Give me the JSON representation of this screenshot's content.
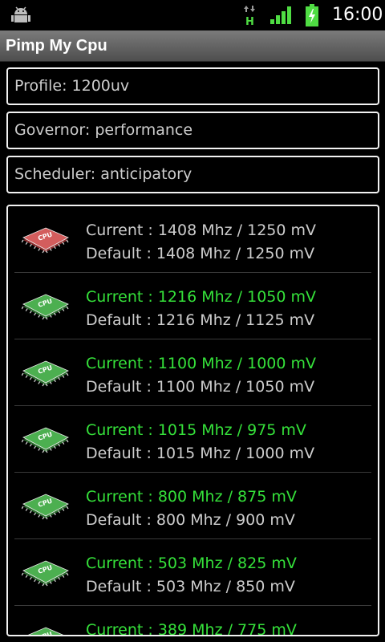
{
  "status_bar": {
    "time": "16:00",
    "icons": [
      "android-debug-icon",
      "network-data-icon",
      "signal-strength-icon",
      "battery-charging-icon"
    ],
    "network_label": "H"
  },
  "app": {
    "title": "Pimp My Cpu"
  },
  "settings": {
    "profile": "Profile: 1200uv",
    "governor": "Governor: performance",
    "scheduler": "Scheduler: anticipatory"
  },
  "frequencies": [
    {
      "current": "Current : 1408 Mhz / 1250 mV",
      "default": "Default : 1408 Mhz / 1250 mV",
      "chip_color": "red"
    },
    {
      "current": "Current : 1216 Mhz / 1050 mV",
      "default": "Default : 1216 Mhz / 1125 mV",
      "chip_color": "green"
    },
    {
      "current": "Current : 1100 Mhz / 1000 mV",
      "default": "Default : 1100 Mhz / 1050 mV",
      "chip_color": "green"
    },
    {
      "current": "Current : 1015 Mhz / 975 mV",
      "default": "Default : 1015 Mhz / 1000 mV",
      "chip_color": "green"
    },
    {
      "current": "Current : 800 Mhz / 875 mV",
      "default": "Default : 800 Mhz / 900 mV",
      "chip_color": "green"
    },
    {
      "current": "Current : 503 Mhz / 825 mV",
      "default": "Default : 503 Mhz / 850 mV",
      "chip_color": "green"
    },
    {
      "current": "Current : 389 Mhz / 775 mV",
      "default": "",
      "chip_color": "green"
    }
  ],
  "chip_label": "CPU",
  "colors": {
    "current_active": "#35e13a",
    "chip_red": "#d35d5d",
    "chip_green": "#4caf50"
  }
}
